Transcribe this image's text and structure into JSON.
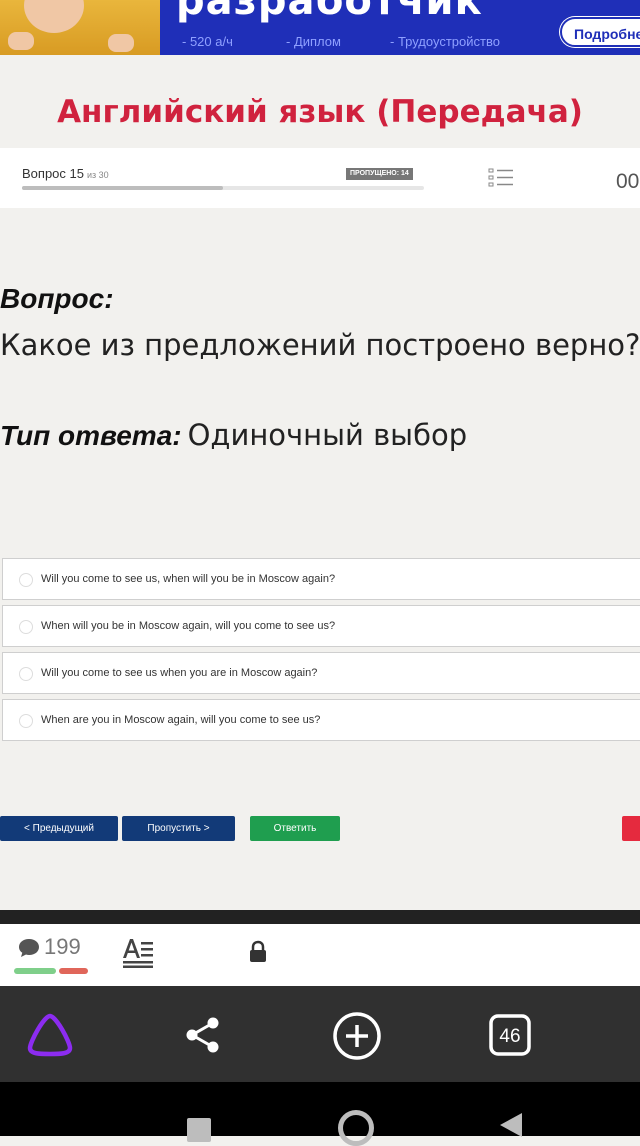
{
  "banner": {
    "headline": "разработчик",
    "tags": [
      "- 520 а/ч",
      "- Диплом",
      "- Трудоустройство"
    ],
    "more_button": "Подробнее"
  },
  "page_title": "Английский язык (Передача)",
  "progress": {
    "question_label": "Вопрос 15",
    "of_label": "из 30",
    "skipped_badge": "ПРОПУЩЕНО: 14",
    "fraction_complete": 0.5,
    "timer": "00"
  },
  "question": {
    "heading": "Вопрос:",
    "text": "Какое из предложений построено верно?",
    "answer_type_label": "Тип ответа:",
    "answer_type_value": "Одиночный выбор"
  },
  "options": [
    "Will you come to see us, when will you be in Moscow again?",
    "When will you be in Moscow again, will you come to see us?",
    "Will you come to see us when you are in Moscow again?",
    "When are you in Moscow again, will you come to see us?"
  ],
  "buttons": {
    "prev": "< Предыдущий",
    "skip": "Пропустить >",
    "answer": "Ответить"
  },
  "content_bar": {
    "comment_count": "199",
    "vote_positive_fraction": 0.59
  },
  "browser_toolbar": {
    "tabs_count": "46",
    "icons": [
      "alice-assistant-icon",
      "share-icon",
      "new-tab-icon",
      "tabs-icon"
    ]
  },
  "colors": {
    "title_red": "#d0223e",
    "nav_blue": "#123a78",
    "answer_green": "#1f9e4f",
    "banner_blue": "#1f2fb8"
  }
}
